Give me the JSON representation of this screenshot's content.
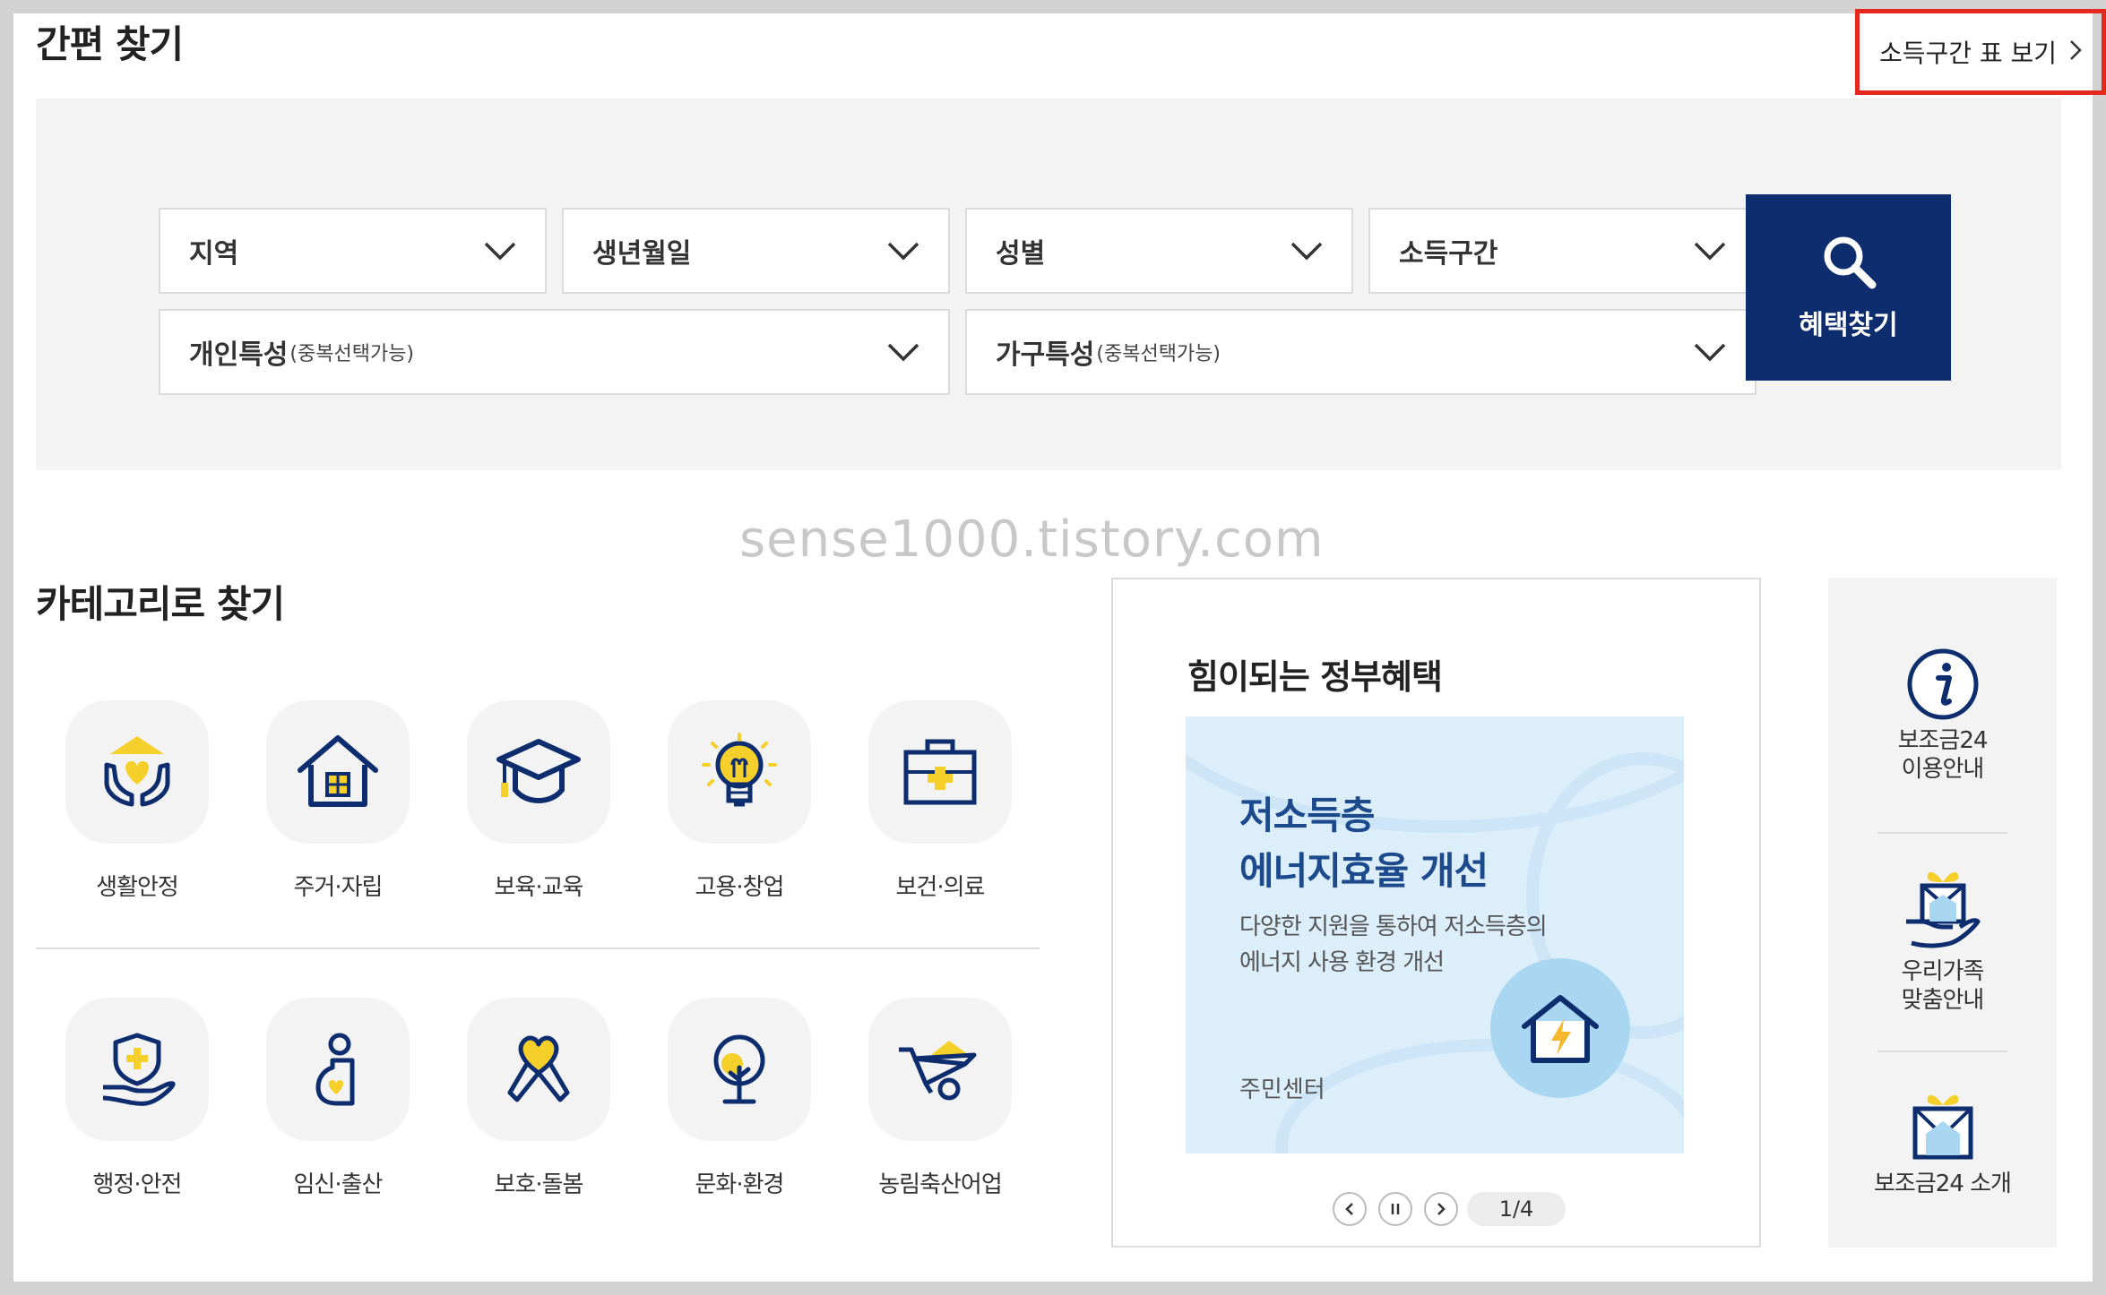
{
  "quick_search": {
    "title": "간편 찾기",
    "income_table_link": "소득구간 표 보기",
    "filters": {
      "region": "지역",
      "birth": "생년월일",
      "gender": "성별",
      "income": "소득구간",
      "personal": "개인특성",
      "personal_note": "(중복선택가능)",
      "household": "가구특성",
      "household_note": "(중복선택가능)"
    },
    "search_button": "혜택찾기"
  },
  "watermark": "sense1000.tistory.com",
  "categories": {
    "title": "카테고리로 찾기",
    "items": [
      {
        "label": "생활안정",
        "icon": "hands-heart-icon"
      },
      {
        "label": "주거·자립",
        "icon": "house-icon"
      },
      {
        "label": "보육·교육",
        "icon": "graduation-cap-icon"
      },
      {
        "label": "고용·창업",
        "icon": "lightbulb-icon"
      },
      {
        "label": "보건·의료",
        "icon": "medical-kit-icon"
      },
      {
        "label": "행정·안전",
        "icon": "shield-hand-icon"
      },
      {
        "label": "임신·출산",
        "icon": "pregnancy-icon"
      },
      {
        "label": "보호·돌봄",
        "icon": "ribbon-heart-icon"
      },
      {
        "label": "문화·환경",
        "icon": "tree-icon"
      },
      {
        "label": "농림축산어업",
        "icon": "wheelbarrow-icon"
      }
    ]
  },
  "gov_benefits": {
    "title": "힘이되는 정부혜택",
    "banner": {
      "heading_line1": "저소득층",
      "heading_line2": "에너지효율 개선",
      "desc_line1": "다양한 지원을 통하여 저소득층의",
      "desc_line2": "에너지 사용 환경 개선",
      "org": "주민센터"
    },
    "pager": "1/4"
  },
  "side_menu": [
    {
      "label": "보조금24\n이용안내",
      "icon": "info-icon"
    },
    {
      "label": "우리가족\n맞춤안내",
      "icon": "family-gift-icon"
    },
    {
      "label": "보조금24 소개",
      "icon": "gift-box-icon"
    }
  ],
  "colors": {
    "navy": "#0d2d6e",
    "accent_yellow": "#f5cf2a",
    "highlight_red": "#e5281d",
    "panel_gray": "#f3f3f3"
  }
}
